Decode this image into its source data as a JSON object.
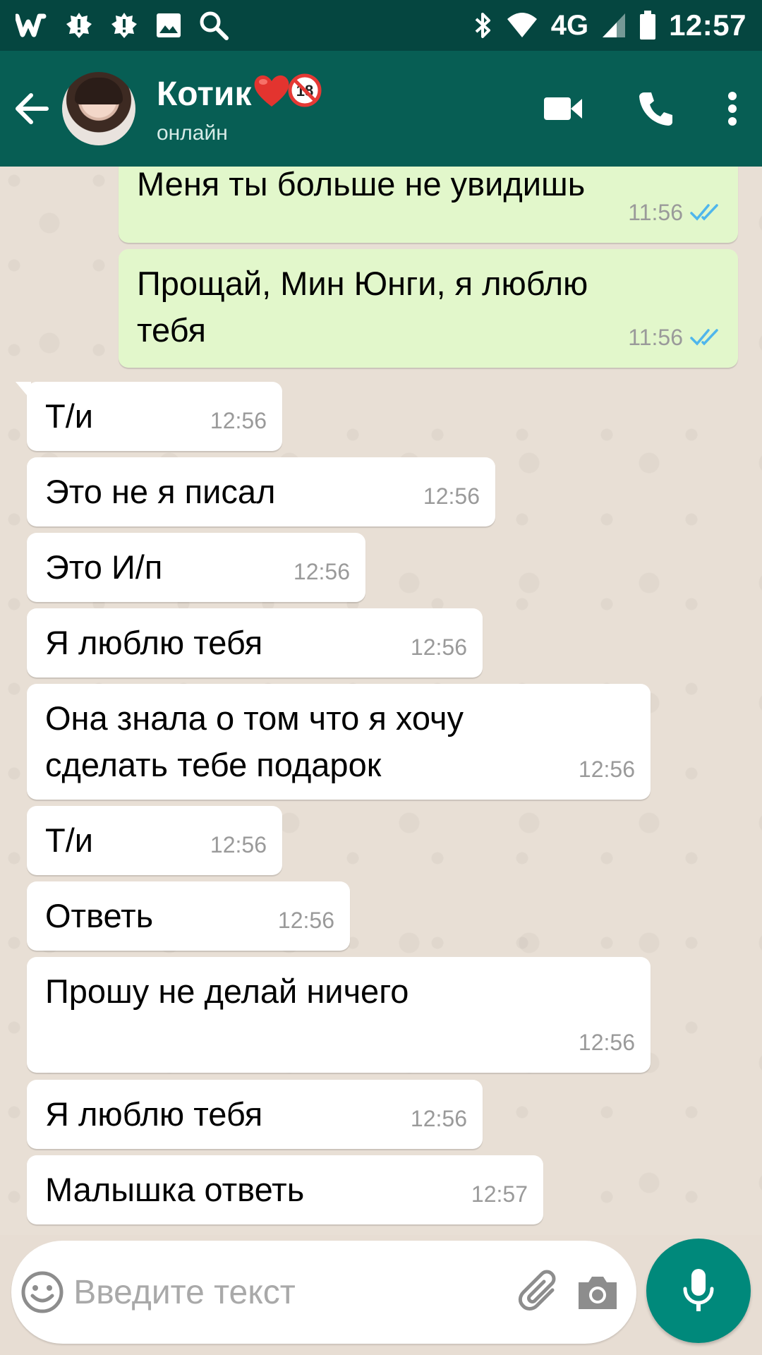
{
  "status_bar": {
    "time": "12:57",
    "network": "4G",
    "icons": [
      "wattpad-icon",
      "alert-badge-icon",
      "alert-badge-icon",
      "image-icon",
      "search-icon",
      "bluetooth-icon",
      "wifi-icon",
      "signal-icon",
      "battery-icon"
    ]
  },
  "header": {
    "contact_name": "Котик",
    "contact_emoji": [
      "red-heart",
      "no-under-18"
    ],
    "status": "онлайн",
    "actions": [
      "video-call-icon",
      "phone-icon",
      "more-vert-icon"
    ]
  },
  "colors": {
    "status_bar": "#054640",
    "app_bar": "#075e54",
    "outgoing_bubble": "#e2f7cb",
    "incoming_bubble": "#ffffff",
    "read_ticks": "#4fb6ec",
    "mic_button": "#00897b"
  },
  "messages": [
    {
      "direction": "out",
      "text": "Меня ты больше не увидишь",
      "time": "11:56",
      "read": true
    },
    {
      "direction": "out",
      "text": "Прощай, Мин Юнги, я люблю тебя",
      "time": "11:56",
      "read": true
    },
    {
      "direction": "in",
      "text": "Т/и",
      "time": "12:56"
    },
    {
      "direction": "in",
      "text": "Это не я писал",
      "time": "12:56"
    },
    {
      "direction": "in",
      "text": "Это И/п",
      "time": "12:56"
    },
    {
      "direction": "in",
      "text": "Я люблю тебя",
      "time": "12:56"
    },
    {
      "direction": "in",
      "text": "Она знала о том что я хочу сделать тебе подарок",
      "time": "12:56"
    },
    {
      "direction": "in",
      "text": "Т/и",
      "time": "12:56"
    },
    {
      "direction": "in",
      "text": "Ответь",
      "time": "12:56"
    },
    {
      "direction": "in",
      "text": "Прошу не делай ничего",
      "time": "12:56"
    },
    {
      "direction": "in",
      "text": "Я люблю тебя",
      "time": "12:56"
    },
    {
      "direction": "in",
      "text": "Малышка ответь",
      "time": "12:57"
    }
  ],
  "composer": {
    "placeholder": "Введите текст",
    "value": ""
  }
}
